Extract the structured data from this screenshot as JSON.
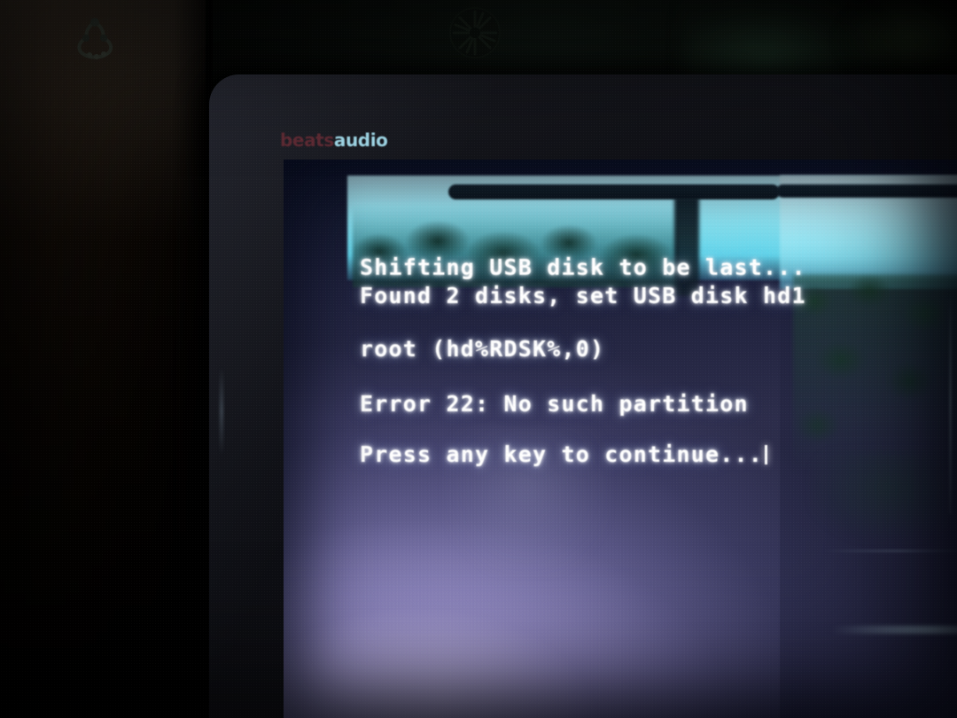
{
  "scene": {
    "description": "Photograph of a laptop screen showing a GRUB bootloader error",
    "device_brand_mark": "beats",
    "device_brand_word": "audio"
  },
  "console": {
    "lines": [
      "Shifting USB disk to be last...",
      "Found 2 disks, set USB disk hd1",
      "root (hd%RDSK%,0)",
      "Error 22: No such partition",
      "Press any key to continue..."
    ],
    "line_0": "Shifting USB disk to be last...",
    "line_1": "Found 2 disks, set USB disk hd1",
    "line_2": "root (hd%RDSK%,0)",
    "line_3": "Error 22: No such partition",
    "line_4": "Press any key to continue...",
    "error_code": "Error 22",
    "error_message": "No such partition",
    "disk_count": "2",
    "usb_disk_assignment": "hd1",
    "root_device": "(hd%RDSK%,0)",
    "cursor_visible": true
  },
  "colors": {
    "console_text": "#ffffff",
    "screen_glow": "#b8aee0",
    "reflection_cyan": "#8fe8f7",
    "foliage_green": "#1c3a28",
    "bezel": "#0e0f14",
    "wood_panel": "#3a2f23",
    "beats_mark": "#5e2a33",
    "beats_word": "#9fd6e6"
  },
  "background": {
    "left_object": "wood-panel",
    "hook_ornament": "coat-hook",
    "ceiling_ornament": "rosette-medallion"
  }
}
